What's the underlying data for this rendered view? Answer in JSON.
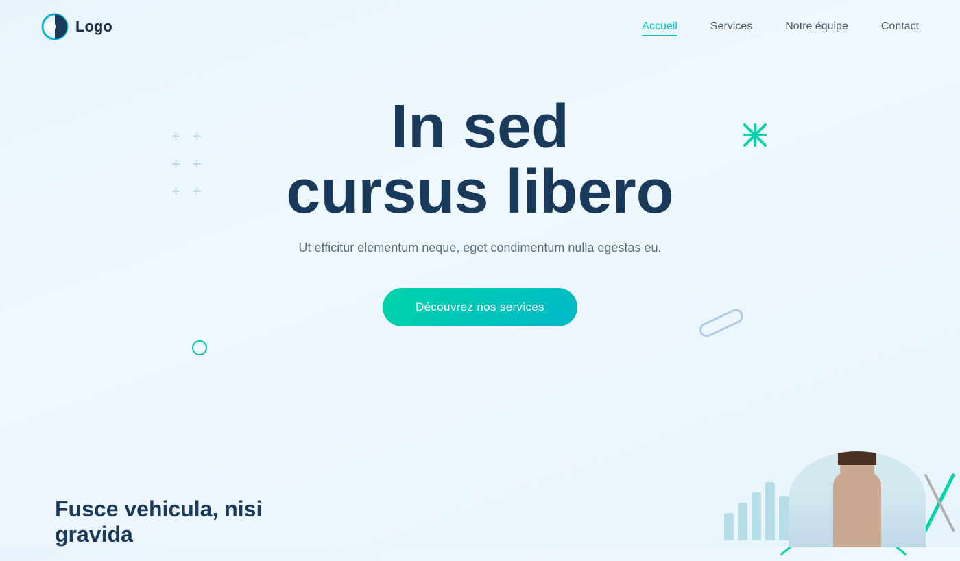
{
  "brand": {
    "logo_text": "Logo"
  },
  "navbar": {
    "links": [
      {
        "label": "Accueil",
        "active": true
      },
      {
        "label": "Services",
        "active": false
      },
      {
        "label": "Notre équipe",
        "active": false
      },
      {
        "label": "Contact",
        "active": false
      }
    ]
  },
  "hero": {
    "title_line1": "In sed",
    "title_line2": "cursus libero",
    "subtitle": "Ut efficitur elementum neque, eget condimentum nulla egestas eu.",
    "cta_label": "Découvrez nos services"
  },
  "bottom": {
    "title": "Fusce vehicula, nisi gravida"
  },
  "colors": {
    "accent": "#00c8c8",
    "primary_text": "#1a3a5c",
    "teal_gradient_start": "#00d4aa",
    "teal_gradient_end": "#00b8c8"
  },
  "decorations": {
    "plus_symbol": "+",
    "x_symbol": "✕",
    "circle": "○"
  }
}
